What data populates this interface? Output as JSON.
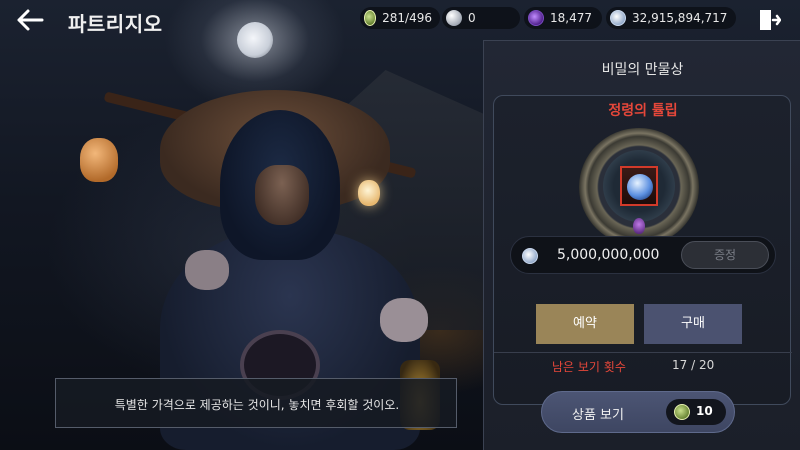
{
  "header": {
    "back_icon": "arrow-left-icon",
    "title": "파트리지오",
    "exit_icon": "exit-door-icon"
  },
  "currencies": [
    {
      "icon": "stamina-icon",
      "value": "281/496"
    },
    {
      "icon": "pearl-icon",
      "value": "0"
    },
    {
      "icon": "purple-orb-icon",
      "value": "18,477"
    },
    {
      "icon": "silver-icon",
      "value": "32,915,894,717"
    }
  ],
  "panel": {
    "title": "비밀의 만물상",
    "item": {
      "name": "정령의 튤립",
      "icon": "blue-tulip-icon",
      "price": "5,000,000,000",
      "price_icon": "silver-icon",
      "gift_label": "증정"
    },
    "actions": {
      "reserve_label": "예약",
      "buy_label": "구매"
    },
    "views": {
      "label": "남은 보기 횟수",
      "value": "17 / 20"
    },
    "view_goods": {
      "label": "상품 보기",
      "cost_icon": "stamina-icon",
      "cost": "10"
    }
  },
  "dialogue": {
    "text": "특별한 가격으로 제공하는 것이니, 놓치면 후회할 것이오."
  },
  "colors": {
    "accent_red": "#e5473a",
    "reserve_gold": "#9a8558",
    "buy_blue": "#4b5270"
  }
}
